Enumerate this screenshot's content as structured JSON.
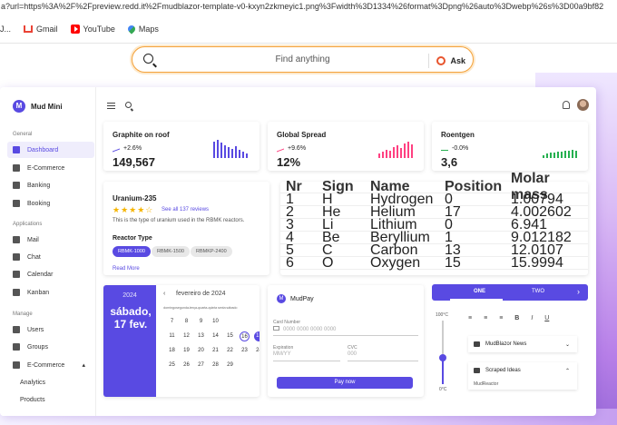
{
  "browser": {
    "url": "a?url=https%3A%2F%2Fpreview.redd.it%2Fmudblazor-template-v0-kxyn2zkmeyic1.png%3Fwidth%3D1334%26format%3Dpng%26auto%3Dwebp%26s%3D00a9bf82",
    "bookmarks": [
      {
        "label": "J...",
        "icon": "bookmark-icon"
      },
      {
        "label": "Gmail",
        "icon": "gmail-icon"
      },
      {
        "label": "YouTube",
        "icon": "youtube-icon"
      },
      {
        "label": "Maps",
        "icon": "maps-icon"
      }
    ],
    "search_placeholder": "Find anything",
    "ask_label": "Ask"
  },
  "app": {
    "name": "Mud Mini",
    "logo_letter": "M",
    "sections": {
      "general": "General",
      "applications": "Applications",
      "manage": "Manage"
    },
    "nav": {
      "dashboard": "Dashboard",
      "ecommerce": "E-Commerce",
      "banking": "Banking",
      "booking": "Booking",
      "mail": "Mail",
      "chat": "Chat",
      "calendar": "Calendar",
      "kanban": "Kanban",
      "users": "Users",
      "groups": "Groups",
      "ecommerce2": "E-Commerce",
      "analytics": "Analytics",
      "products": "Products"
    }
  },
  "stats": [
    {
      "title": "Graphite on roof",
      "pct": "+2.6%",
      "value": "149,567",
      "color": "#594ae2"
    },
    {
      "title": "Global Spread",
      "pct": "+9.6%",
      "value": "12%",
      "color": "#ff4081"
    },
    {
      "title": "Roentgen",
      "pct": "-0.0%",
      "value": "3,6",
      "color": "#26b050"
    }
  ],
  "product": {
    "title": "Uranium-235",
    "stars": "★★★★☆",
    "rating": 4,
    "reviews": "See all 137 reviews",
    "description": "This is the type of uranium used in the RBMK reactors.",
    "reactor_label": "Reactor Type",
    "chips": [
      "RBMK-1000",
      "RBMK-1500",
      "RBMKP-2400"
    ],
    "read_more": "Read More"
  },
  "elements": {
    "headers": [
      "Nr",
      "Sign",
      "Name",
      "Position",
      "Molar mass"
    ],
    "rows": [
      [
        "1",
        "H",
        "Hydrogen",
        "0",
        "1.00794"
      ],
      [
        "2",
        "He",
        "Helium",
        "17",
        "4.002602"
      ],
      [
        "3",
        "Li",
        "Lithium",
        "0",
        "6.941"
      ],
      [
        "4",
        "Be",
        "Beryllium",
        "1",
        "9.012182"
      ],
      [
        "5",
        "C",
        "Carbon",
        "13",
        "12.0107"
      ],
      [
        "6",
        "O",
        "Oxygen",
        "15",
        "15.9994"
      ]
    ]
  },
  "calendar": {
    "year": "2024",
    "date": "sábado, 17 fev.",
    "month": "fevereiro de 2024",
    "dow": "domingosegunda-terça-quarta-quinta sexta sábado",
    "rows": [
      [
        "7",
        "8",
        "9",
        "10"
      ],
      [
        "11",
        "12",
        "13",
        "14",
        "15",
        "16",
        "17"
      ],
      [
        "18",
        "19",
        "20",
        "21",
        "22",
        "23",
        "24"
      ],
      [
        "25",
        "26",
        "27",
        "28",
        "29"
      ]
    ]
  },
  "pay": {
    "brand": "MudPay",
    "card_label": "Card Number",
    "card_placeholder": "0000 0000 0000 0000",
    "exp_label": "Expiration",
    "exp_placeholder": "MM/YY",
    "cvc_label": "CVC",
    "cvc_placeholder": "000",
    "button": "Pay now"
  },
  "misc": {
    "tab_one": "ONE",
    "tab_two": "TWO",
    "temp_high": "100°C",
    "temp_low": "0°C",
    "fmt": [
      "≡",
      "≡",
      "≡",
      "B",
      "I",
      "U"
    ],
    "panel1": "MudBlazor News",
    "panel2": "Scraped Ideas",
    "panel2_content": "MudReactor"
  }
}
